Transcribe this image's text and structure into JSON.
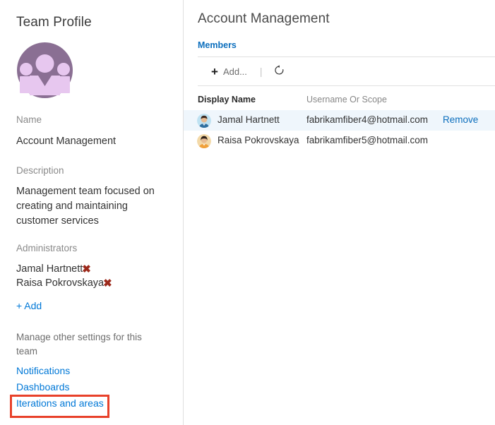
{
  "sidebar": {
    "title": "Team Profile",
    "avatar_icon": "team-group-avatar",
    "name_label": "Name",
    "name_value": "Account Management",
    "description_label": "Description",
    "description_value": "Management team focused on creating and maintaining customer services",
    "administrators_label": "Administrators",
    "administrators": [
      {
        "name": "Jamal Hartnett",
        "remove_icon": "✖"
      },
      {
        "name": "Raisa Pokrovskaya",
        "remove_icon": "✖"
      }
    ],
    "add_admin_label": "+ Add",
    "manage_text": "Manage other settings for this team",
    "links": [
      {
        "label": "Notifications"
      },
      {
        "label": "Dashboards"
      },
      {
        "label": "Iterations and areas"
      }
    ],
    "annotation_color": "#e8412a"
  },
  "main": {
    "title": "Account Management",
    "tab_label": "Members",
    "toolbar": {
      "add_label": "Add...",
      "add_icon": "plus-icon",
      "separator": "|",
      "refresh_icon": "refresh-icon"
    },
    "table": {
      "columns": [
        "Display Name",
        "Username Or Scope"
      ],
      "rows": [
        {
          "avatar_icon": "user-avatar-jamal",
          "display_name": "Jamal Hartnett",
          "username": "fabrikamfiber4@hotmail.com",
          "action": "Remove",
          "selected": true
        },
        {
          "avatar_icon": "user-avatar-raisa",
          "display_name": "Raisa Pokrovskaya",
          "username": "fabrikamfiber5@hotmail.com",
          "action": "",
          "selected": false
        }
      ]
    }
  }
}
